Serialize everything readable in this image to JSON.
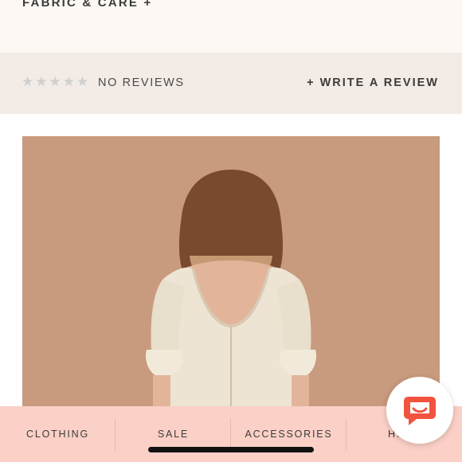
{
  "accordion": {
    "label": "FABRIC & CARE +"
  },
  "reviews": {
    "rating_out_of": 5,
    "rating": 0,
    "star_glyph": "★",
    "summary": "NO REVIEWS",
    "write_label": "+ WRITE A REVIEW"
  },
  "product_image": {
    "icon": "model-back-photo",
    "background_color": "#c89a7e"
  },
  "bottom_nav": {
    "items": [
      {
        "label": "CLOTHING"
      },
      {
        "label": "SALE"
      },
      {
        "label": "ACCESSORIES"
      },
      {
        "label": "H..."
      }
    ]
  },
  "chat": {
    "icon": "chat-bubble-icon",
    "accent_color": "#f2533f"
  },
  "colors": {
    "accordion_bg": "#fdf8f3",
    "reviews_bg": "#f3ebe6",
    "nav_bg": "#fbd0c6",
    "text": "#3b3b3b",
    "star_empty": "#cfcfcf"
  }
}
